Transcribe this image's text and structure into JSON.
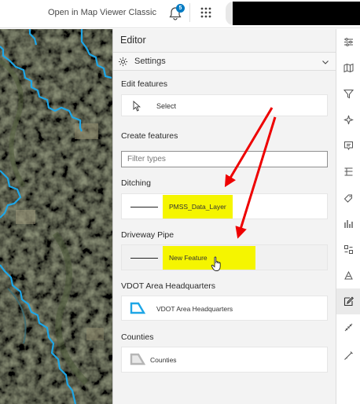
{
  "topbar": {
    "open_classic": "Open in Map Viewer Classic",
    "notification_count": "5"
  },
  "editor": {
    "title": "Editor",
    "settings_label": "Settings",
    "edit_features_heading": "Edit features",
    "select_label": "Select",
    "create_features_heading": "Create features",
    "filter_placeholder": "Filter types",
    "layers": [
      {
        "name": "Ditching",
        "template": "PMSS_Data_Layer",
        "symbol": "line",
        "highlighted": true
      },
      {
        "name": "Driveway Pipe",
        "template": "New Feature",
        "symbol": "line",
        "highlighted": true
      },
      {
        "name": "VDOT Area Headquarters",
        "template": "VDOT Area Headquarters",
        "symbol": "polygon-blue"
      },
      {
        "name": "Counties",
        "template": "Counties",
        "symbol": "polygon-gray"
      }
    ]
  },
  "actionbar": {
    "icons": [
      "properties-icon",
      "basemap-icon",
      "filter-icon",
      "effects-icon",
      "popup-icon",
      "fields-icon",
      "labels-icon",
      "styles-icon",
      "configure-icon",
      "sketch-icon",
      "edit-icon",
      "measure-icon",
      "ruler-icon"
    ],
    "active": "edit-icon"
  },
  "colors": {
    "accent": "#007ac2",
    "highlight": "#f5f500",
    "arrow": "#ee0000",
    "boundary": "#1ea6e6"
  }
}
